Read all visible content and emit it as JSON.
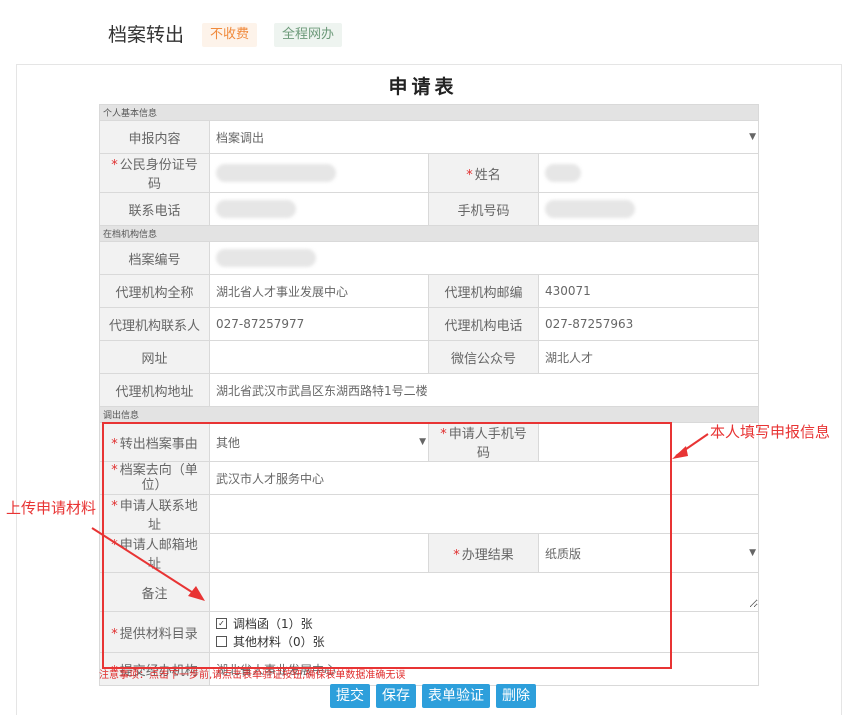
{
  "header": {
    "title": "档案转出",
    "tags": [
      "不收费",
      "全程网办"
    ]
  },
  "form": {
    "title": "申请表",
    "sections": {
      "personal": "个人基本信息",
      "agency": "在档机构信息",
      "transfer": "调出信息"
    },
    "fields": {
      "declare_content": {
        "label": "申报内容",
        "value": "档案调出"
      },
      "id_number": {
        "label": "公民身份证号码"
      },
      "name": {
        "label": "姓名"
      },
      "contact_phone": {
        "label": "联系电话"
      },
      "mobile": {
        "label": "手机号码"
      },
      "file_number": {
        "label": "档案编号"
      },
      "agency_name": {
        "label": "代理机构全称",
        "value": "湖北省人才事业发展中心"
      },
      "agency_postcode": {
        "label": "代理机构邮编",
        "value": "430071"
      },
      "agency_contact": {
        "label": "代理机构联系人",
        "value": "027-87257977"
      },
      "agency_phone": {
        "label": "代理机构电话",
        "value": "027-87257963"
      },
      "website": {
        "label": "网址",
        "value": ""
      },
      "wechat": {
        "label": "微信公众号",
        "value": "湖北人才"
      },
      "agency_address": {
        "label": "代理机构地址",
        "value": "湖北省武汉市武昌区东湖西路特1号二楼"
      },
      "reason": {
        "label": "转出档案事由",
        "value": "其他"
      },
      "applicant_mobile": {
        "label": "申请人手机号码",
        "value": ""
      },
      "destination": {
        "label": "档案去向（单位）",
        "value": "武汉市人才服务中心"
      },
      "applicant_address": {
        "label": "申请人联系地址",
        "value": ""
      },
      "applicant_email_address": {
        "label": "申请人邮箱地址",
        "value": ""
      },
      "result": {
        "label": "办理结果",
        "value": "纸质版"
      },
      "remarks": {
        "label": "备注",
        "value": ""
      },
      "materials": {
        "label": "提供材料目录",
        "items": [
          {
            "text": "调档函（1）张",
            "checked": true
          },
          {
            "text": "其他材料（0）张",
            "checked": false
          }
        ]
      },
      "submit_agency": {
        "label": "提交经办机构",
        "value": "湖北省人事业发展中心"
      }
    }
  },
  "notice": "注意事项：点击下一步前,请点击表单验证按钮,确保表单数据准确无误",
  "buttons": [
    "提交",
    "保存",
    "表单验证",
    "删除"
  ],
  "annotations": {
    "right": "本人填写申报信息",
    "left": "上传申请材料"
  },
  "colors": {
    "annotation": "#e83434",
    "button": "#2d9fdb",
    "required": "#e02c2c"
  }
}
